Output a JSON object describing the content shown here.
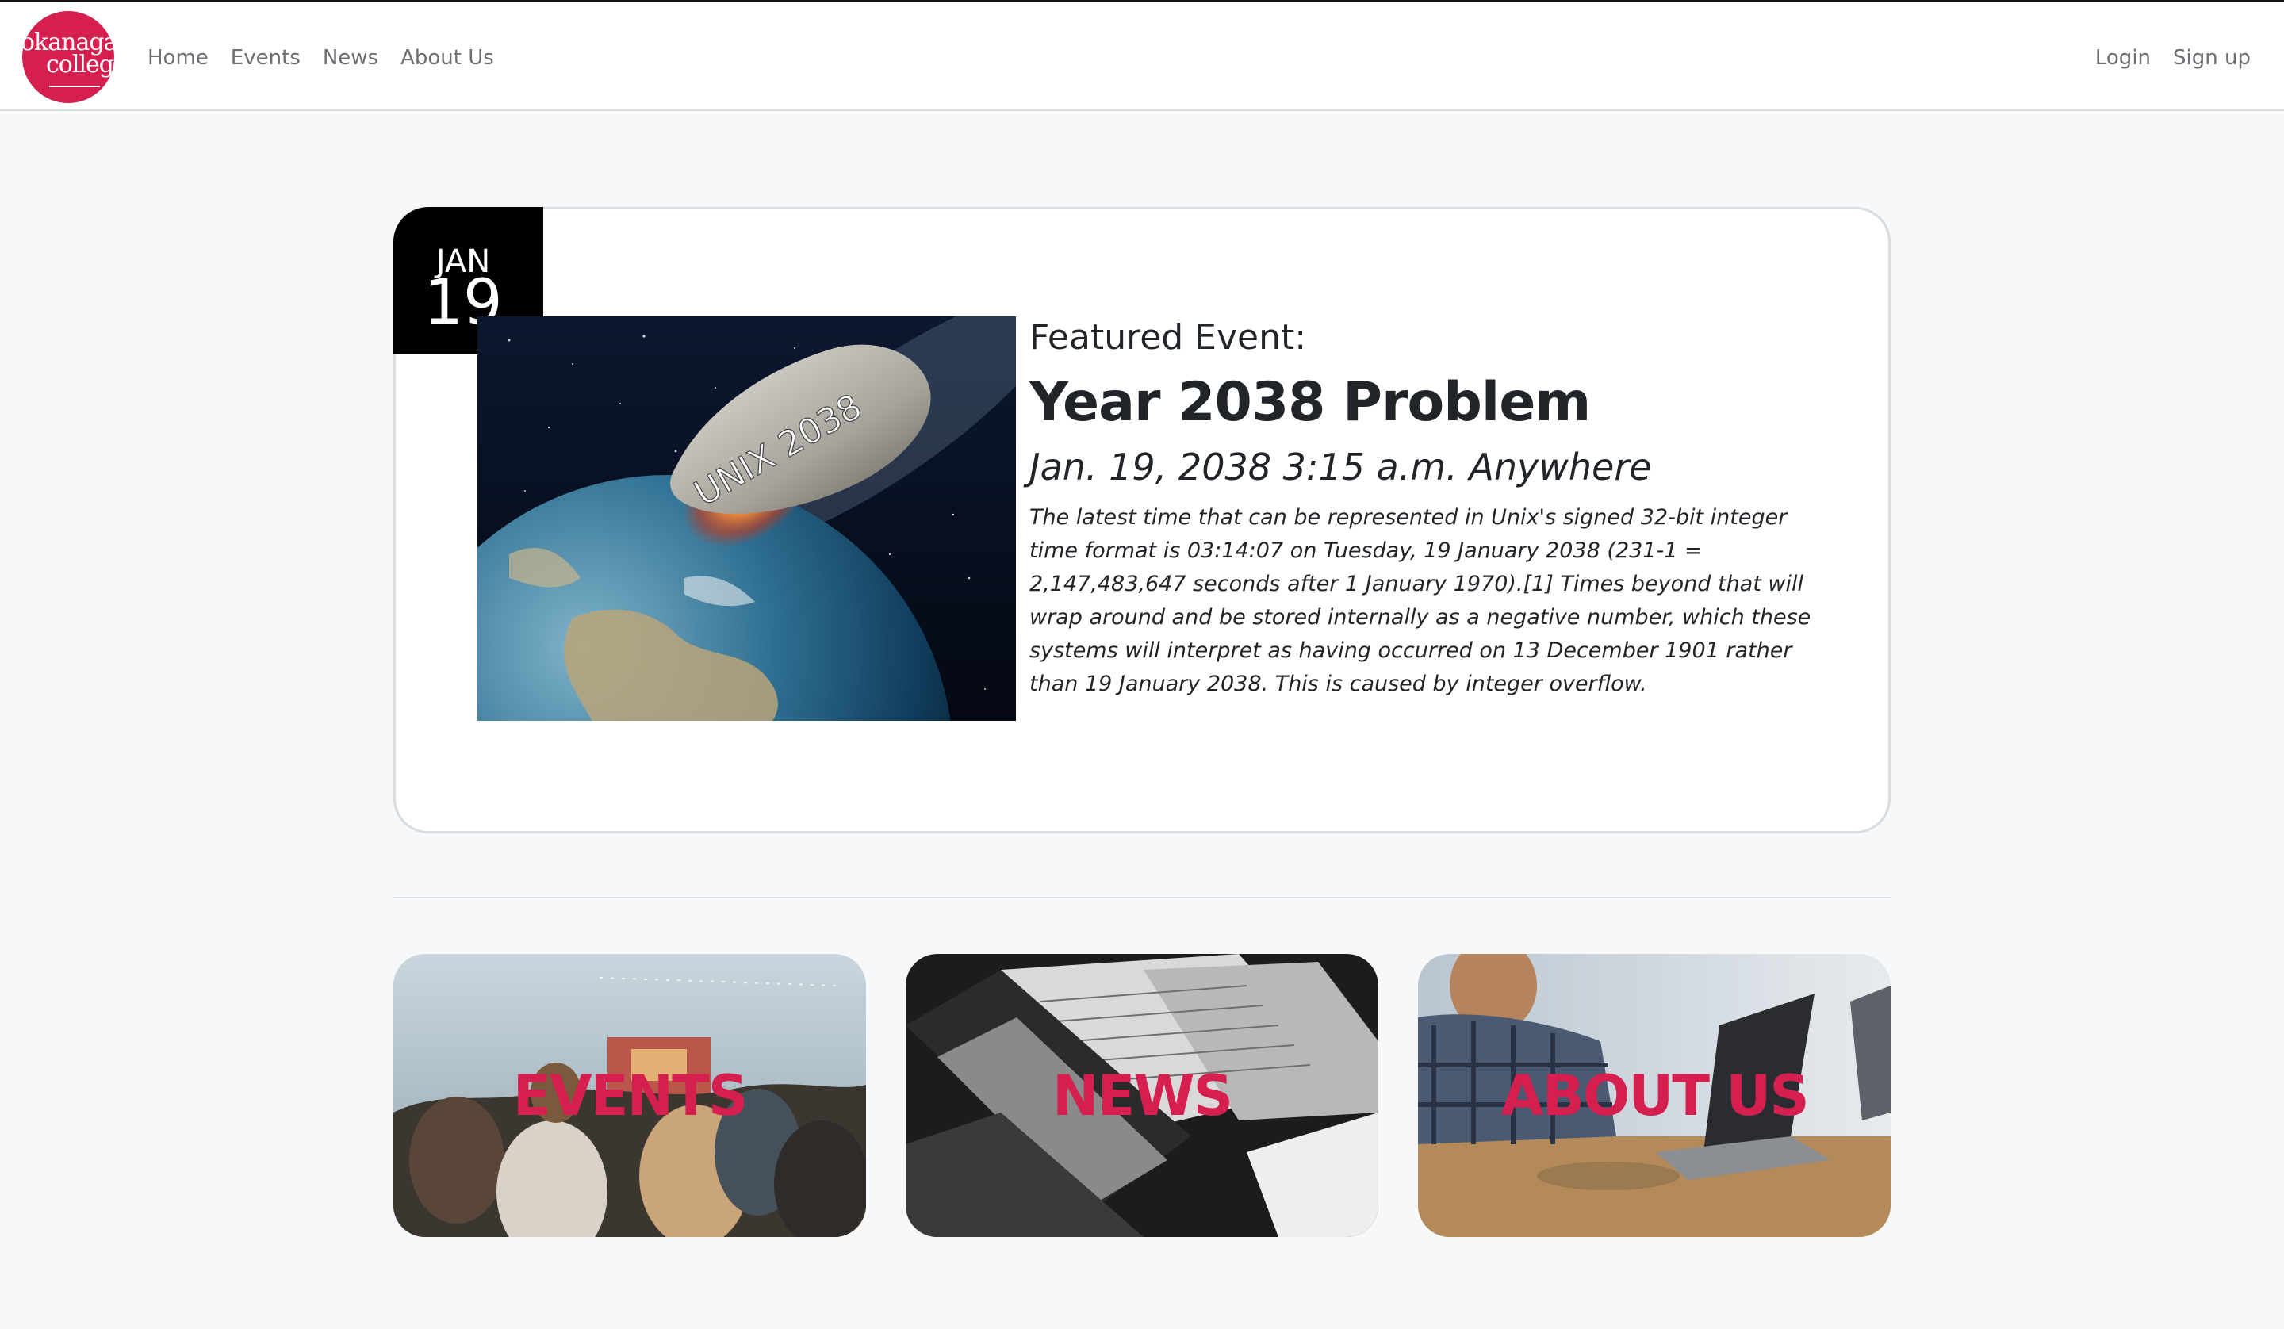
{
  "brand": {
    "logo_line1": "okanagan",
    "logo_line2": "college",
    "accent_color": "#d41f4f"
  },
  "nav": {
    "links": [
      "Home",
      "Events",
      "News",
      "About Us"
    ],
    "login": "Login",
    "signup": "Sign up"
  },
  "featured": {
    "month": "JAN",
    "day": "19",
    "label": "Featured Event:",
    "title": "Year 2038 Problem",
    "when": "Jan. 19, 2038 3:15 a.m. Anywhere",
    "description": "The latest time that can be represented in Unix's signed 32-bit integer time format is 03:14:07 on Tuesday, 19 January 2038 (231-1 = 2,147,483,647 seconds after 1 January 1970).[1] Times beyond that will wrap around and be stored internally as a negative number, which these systems will interpret as having occurred on 13 December 1901 rather than 19 January 2038. This is caused by integer overflow.",
    "image_text": "UNIX 2038"
  },
  "tiles": {
    "events": "EVENTS",
    "news": "NEWS",
    "about": "ABOUT US"
  }
}
